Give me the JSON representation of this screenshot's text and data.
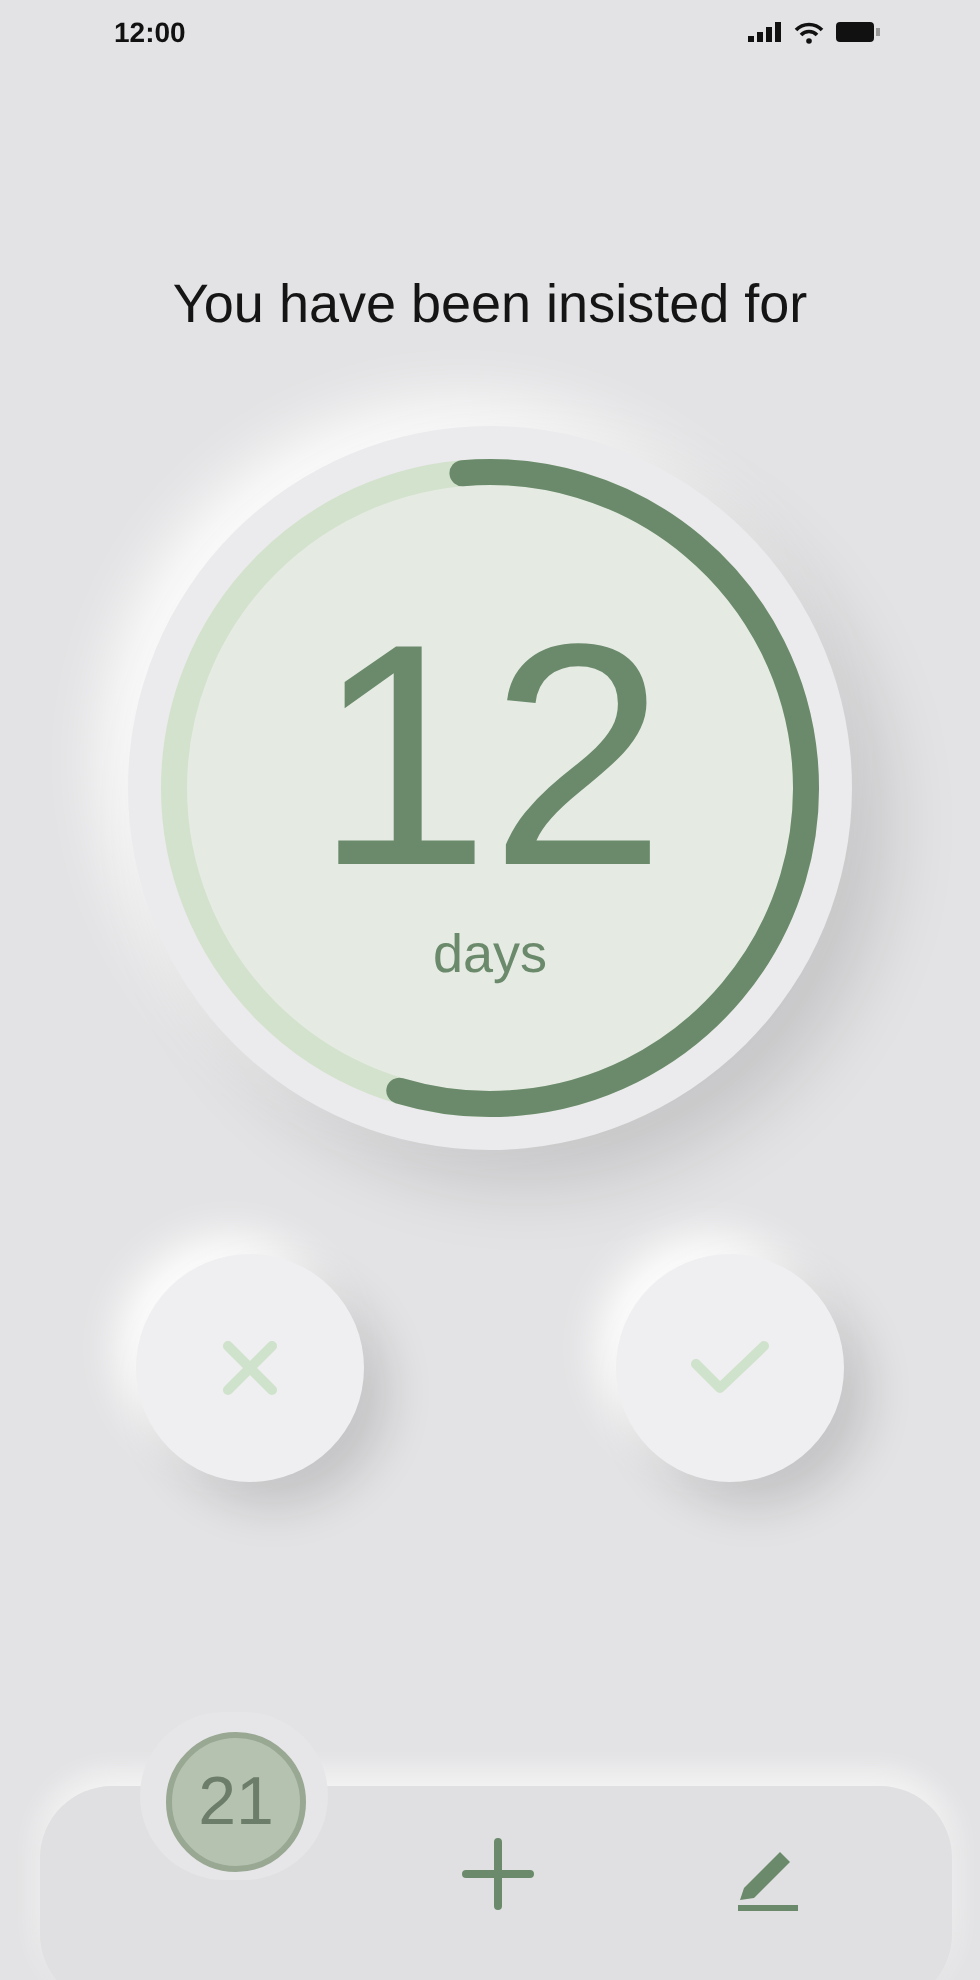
{
  "status_bar": {
    "time": "12:00"
  },
  "heading": "You have been insisted for",
  "counter": {
    "value": "12",
    "unit": "days",
    "level": 0.56
  },
  "actions": [
    {
      "kind": "reject"
    },
    {
      "kind": "accept"
    }
  ],
  "bottom_bar": {
    "badge": "21",
    "buttons": [
      {
        "kind": "add"
      },
      {
        "kind": "edit"
      }
    ]
  }
}
